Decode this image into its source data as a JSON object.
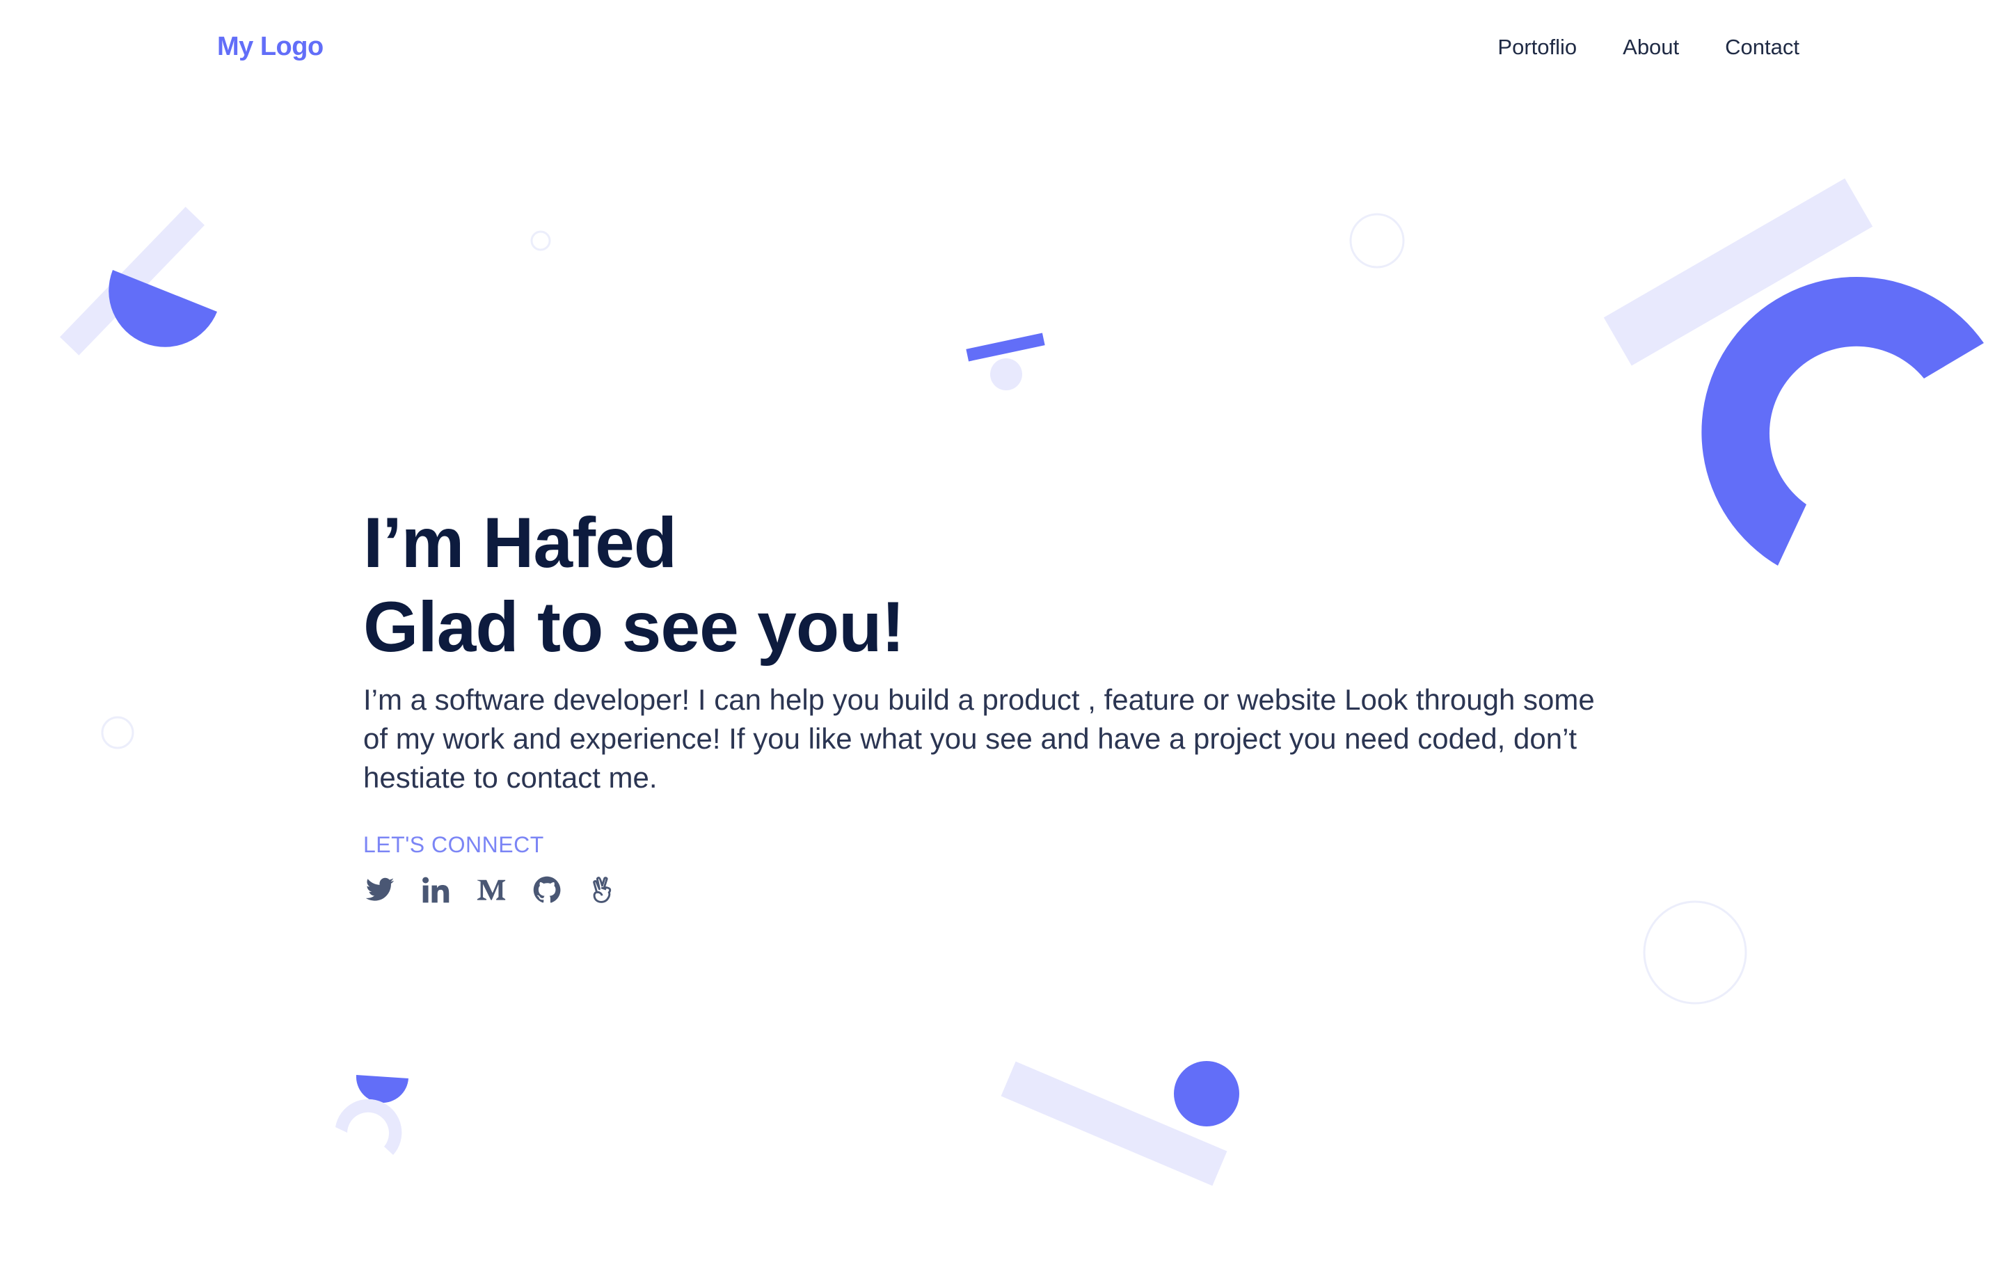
{
  "header": {
    "logo": "My Logo",
    "nav": [
      {
        "label": "Portoflio"
      },
      {
        "label": "About"
      },
      {
        "label": "Contact"
      }
    ]
  },
  "hero": {
    "line1": "I’m Hafed",
    "line2": "Glad to see you!",
    "description": "I’m a software developer! I can help you build a product , feature or website Look through some of my work and experience! If you like what you see and have a project you need coded, don’t hestiate to contact me.",
    "connect_label": "LET'S CONNECT"
  },
  "social": [
    {
      "icon": "twitter-icon"
    },
    {
      "icon": "linkedin-icon"
    },
    {
      "icon": "medium-icon"
    },
    {
      "icon": "github-icon"
    },
    {
      "icon": "angellist-icon"
    }
  ],
  "colors": {
    "accent": "#626ef8",
    "accent_light": "#e8e9fd",
    "heading": "#0d1b3e",
    "body_text": "#2b3552",
    "icon": "#4a5774"
  }
}
